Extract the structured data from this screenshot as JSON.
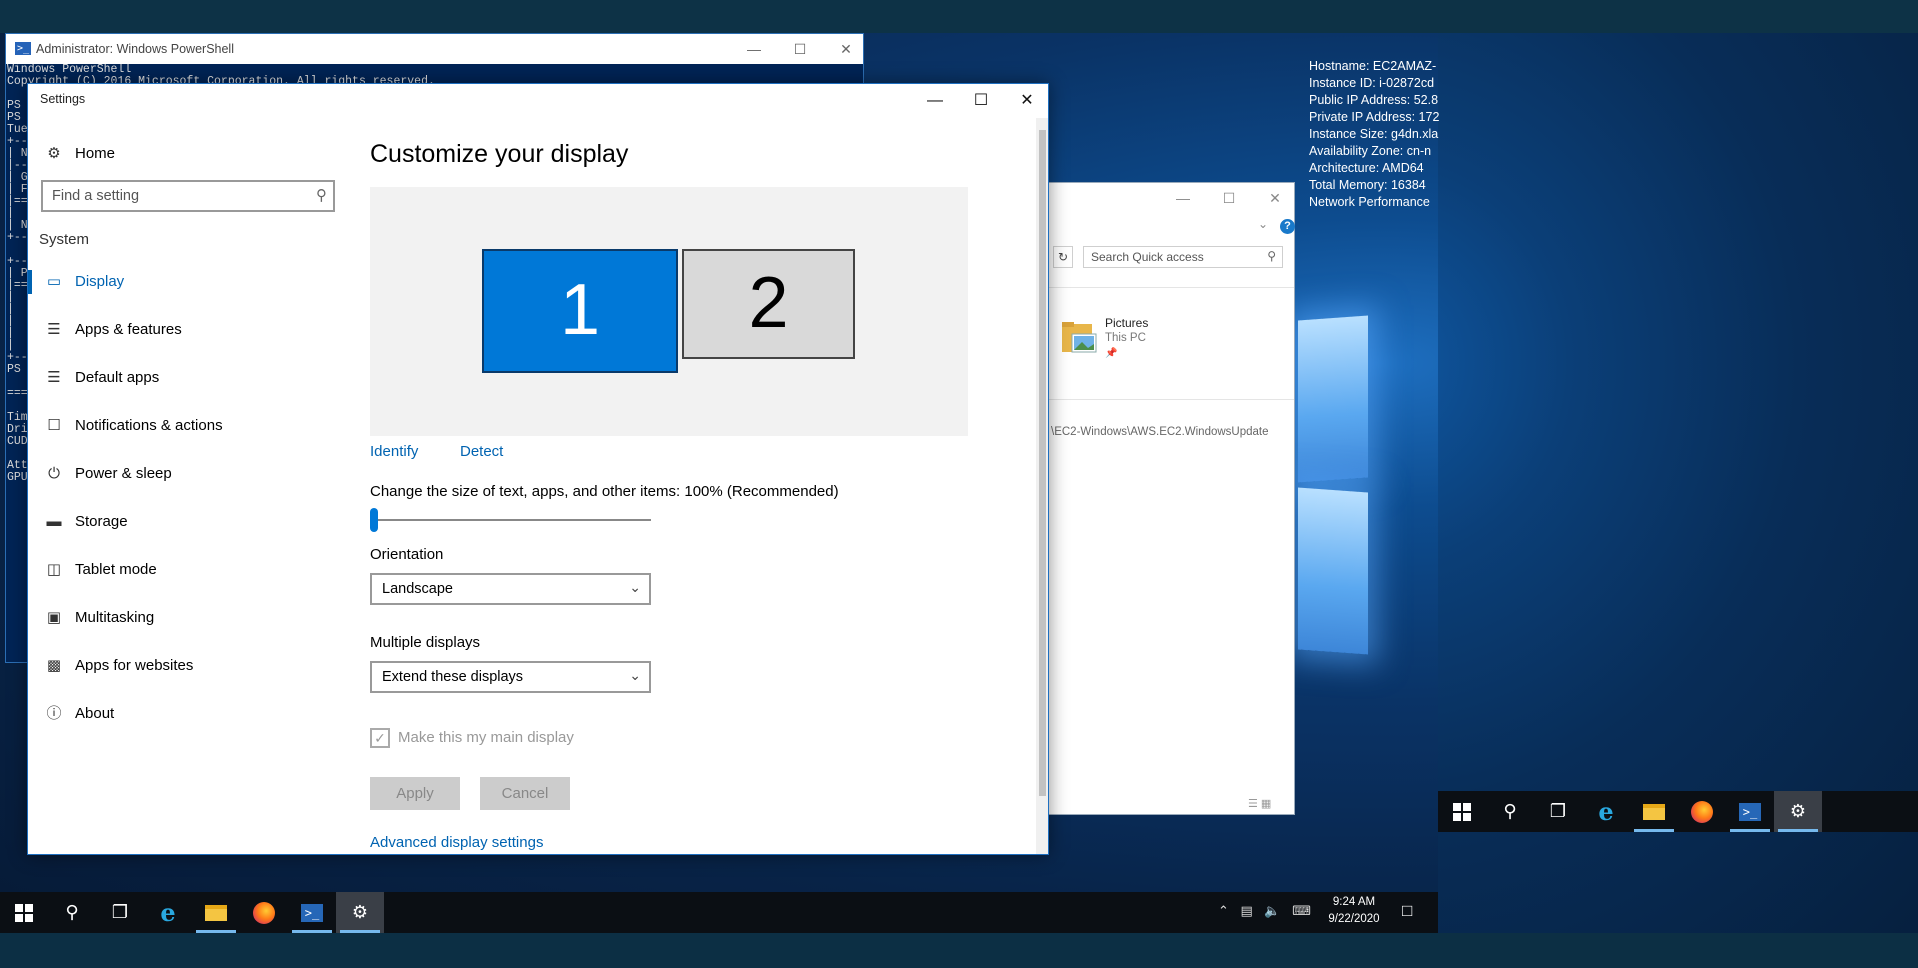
{
  "desktop": {
    "sysinfo": [
      "Hostname: EC2AMAZ-",
      "Instance ID: i-02872cd",
      "Public IP Address: 52.8",
      "Private IP Address: 172",
      "Instance Size: g4dn.xla",
      "Availability Zone: cn-n",
      "Architecture: AMD64",
      "Total Memory: 16384",
      "Network Performance"
    ]
  },
  "powershell": {
    "title": "Administrator: Windows PowerShell",
    "body": "Windows PowerShell\nCopyright (C) 2016 Microsoft Corporation. All rights reserved.\n\nPS\nPS\nTue\n+--\n| N\n|--\n| G\n| F\n|==\n|\n| N\n+--\n\n+--\n| P\n|==\n|\n|\n|\n|\n|\n+--\nPS\n\n===\n\nTim\nDri\nCUD\n\nAtt\nGPU"
  },
  "explorer": {
    "search_placeholder": "Search Quick access",
    "item_name": "Pictures",
    "item_location": "This PC",
    "path_text": "\\EC2-Windows\\AWS.EC2.WindowsUpdate"
  },
  "settings": {
    "window_title": "Settings",
    "home_label": "Home",
    "search_placeholder": "Find a setting",
    "section_label": "System",
    "nav_items": [
      {
        "label": "Display",
        "icon": "monitor-icon",
        "active": true
      },
      {
        "label": "Apps & features",
        "icon": "list-icon"
      },
      {
        "label": "Default apps",
        "icon": "default-apps-icon"
      },
      {
        "label": "Notifications & actions",
        "icon": "notification-icon"
      },
      {
        "label": "Power & sleep",
        "icon": "power-icon"
      },
      {
        "label": "Storage",
        "icon": "storage-icon"
      },
      {
        "label": "Tablet mode",
        "icon": "tablet-icon"
      },
      {
        "label": "Multitasking",
        "icon": "multitasking-icon"
      },
      {
        "label": "Apps for websites",
        "icon": "apps-websites-icon"
      },
      {
        "label": "About",
        "icon": "info-icon"
      }
    ],
    "page_title": "Customize your display",
    "monitor_1": "1",
    "monitor_2": "2",
    "identify_label": "Identify",
    "detect_label": "Detect",
    "scale_label": "Change the size of text, apps, and other items: 100% (Recommended)",
    "scale_value_fraction": 0,
    "orientation_label": "Orientation",
    "orientation_value": "Landscape",
    "multiple_displays_label": "Multiple displays",
    "multiple_displays_value": "Extend these displays",
    "main_display_label": "Make this my main display",
    "main_display_checked": true,
    "apply_label": "Apply",
    "cancel_label": "Cancel",
    "advanced_label": "Advanced display settings"
  },
  "taskbar": {
    "time": "9:24 AM",
    "date": "9/22/2020",
    "accent": "#76b9ed"
  }
}
